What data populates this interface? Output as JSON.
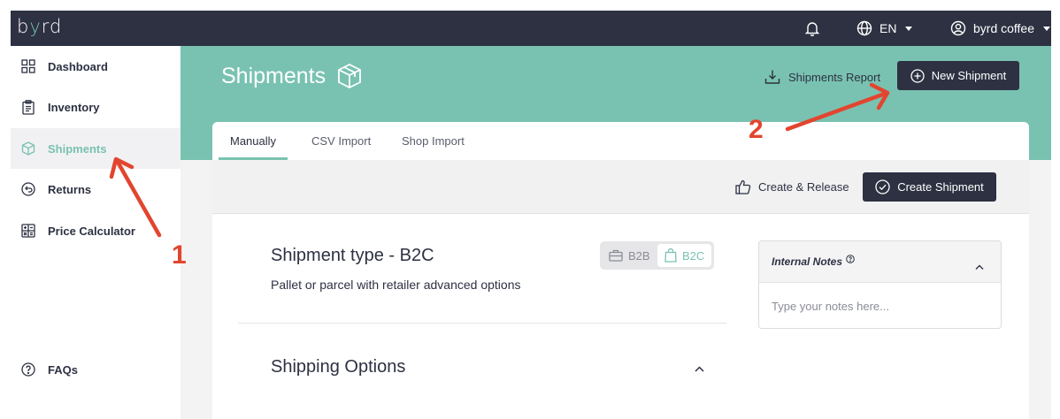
{
  "app": {
    "logo": "byrd"
  },
  "topbar": {
    "language": "EN",
    "user": "byrd coffee"
  },
  "sidebar": {
    "items": [
      {
        "label": "Dashboard",
        "icon": "dashboard-grid-icon"
      },
      {
        "label": "Inventory",
        "icon": "clipboard-icon"
      },
      {
        "label": "Shipments",
        "icon": "box-icon",
        "active": true
      },
      {
        "label": "Returns",
        "icon": "return-arrow-icon"
      },
      {
        "label": "Price Calculator",
        "icon": "calculator-icon"
      }
    ],
    "faq": {
      "label": "FAQs",
      "icon": "question-circle-icon"
    }
  },
  "header": {
    "title": "Shipments",
    "report_label": "Shipments Report",
    "new_label": "New Shipment"
  },
  "tabs": [
    {
      "label": "Manually",
      "active": true
    },
    {
      "label": "CSV Import"
    },
    {
      "label": "Shop Import"
    }
  ],
  "actions": {
    "release_label": "Create & Release",
    "create_label": "Create Shipment"
  },
  "shipment": {
    "type_title": "Shipment type - B2C",
    "type_subtitle": "Pallet or parcel with retailer advanced options",
    "toggle": {
      "b2b": "B2B",
      "b2c": "B2C",
      "selected": "B2C"
    },
    "options_title": "Shipping Options"
  },
  "notes": {
    "title": "Internal Notes",
    "placeholder": "Type your notes here..."
  },
  "annotations": {
    "one": "1",
    "two": "2"
  },
  "colors": {
    "accent": "#79c2b1",
    "dark": "#2d3142",
    "annotation": "#e2452f"
  }
}
